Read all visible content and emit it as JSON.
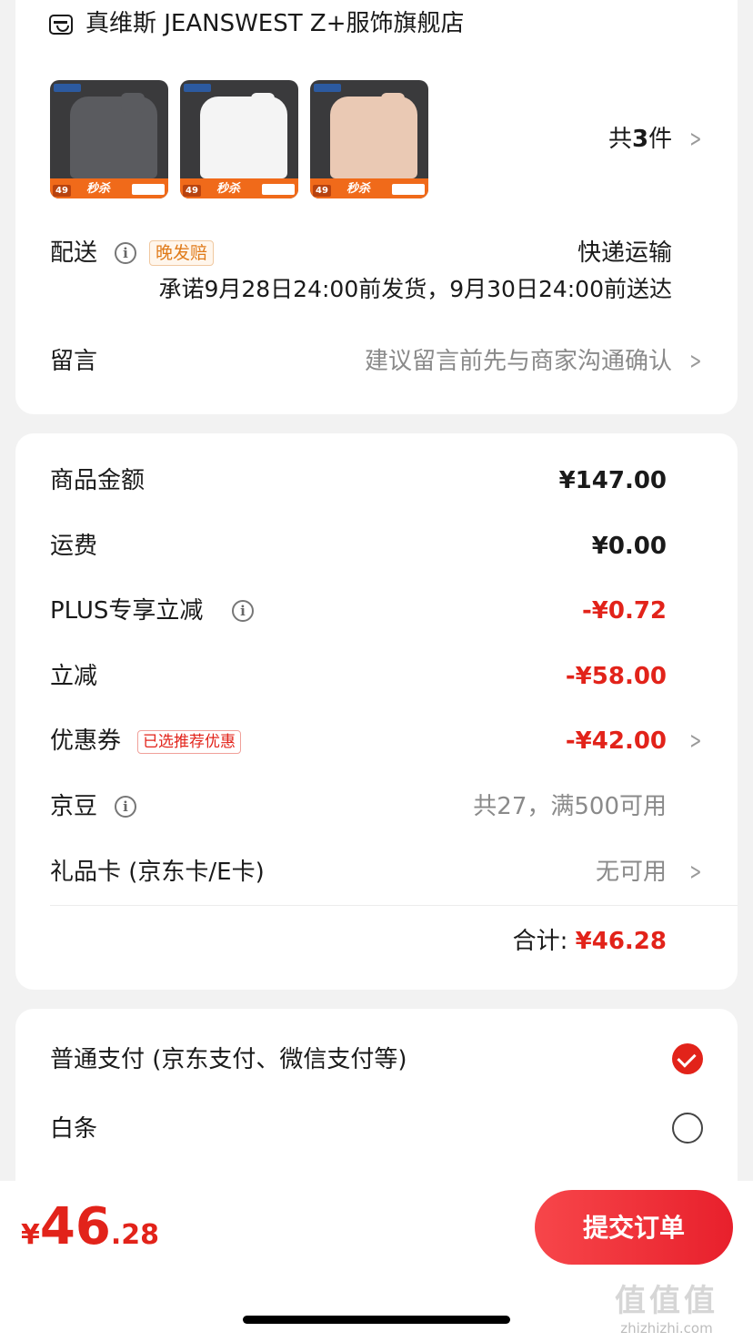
{
  "store": {
    "name": "真维斯 JEANSWEST Z+服饰旗舰店",
    "products": [
      {
        "color": "#5a5b5f"
      },
      {
        "color": "#f4f4f4"
      },
      {
        "color": "#eac9b4"
      }
    ],
    "product_tag_price": "49",
    "product_tag_text": "秒杀",
    "count_prefix": "共",
    "count_number": "3",
    "count_suffix": "件"
  },
  "delivery": {
    "label": "配送",
    "tag": "晚发赔",
    "method": "快递运输",
    "promise": "承诺9月28日24:00前发货，9月30日24:00前送达"
  },
  "message": {
    "label": "留言",
    "placeholder": "建议留言前先与商家沟通确认"
  },
  "price": {
    "goods_label": "商品金额",
    "goods_value": "¥147.00",
    "shipping_label": "运费",
    "shipping_value": "¥0.00",
    "plus_label": "PLUS专享立减",
    "plus_value": "-¥0.72",
    "discount_label": "立减",
    "discount_value": "-¥58.00",
    "coupon_label": "优惠券",
    "coupon_tag": "已选推荐优惠",
    "coupon_value": "-¥42.00",
    "jingdou_label": "京豆",
    "jingdou_value": "共27，满500可用",
    "giftcard_label": "礼品卡 (京东卡/E卡)",
    "giftcard_value": "无可用",
    "total_label": "合计:",
    "total_value": "¥46.28"
  },
  "payment": {
    "option1": "普通支付 (京东支付、微信支付等)",
    "option1_selected": true,
    "option2": "白条",
    "option2_selected": false
  },
  "bottom": {
    "currency": "¥",
    "amount_int": "46",
    "amount_dec": ".28",
    "submit": "提交订单"
  },
  "watermark": {
    "logo": "值值值",
    "url": "zhizhizhi.com"
  },
  "colors": {
    "accent_red": "#e2231a",
    "tag_orange": "#e07b1a",
    "grey_text": "#8a8a8a"
  }
}
